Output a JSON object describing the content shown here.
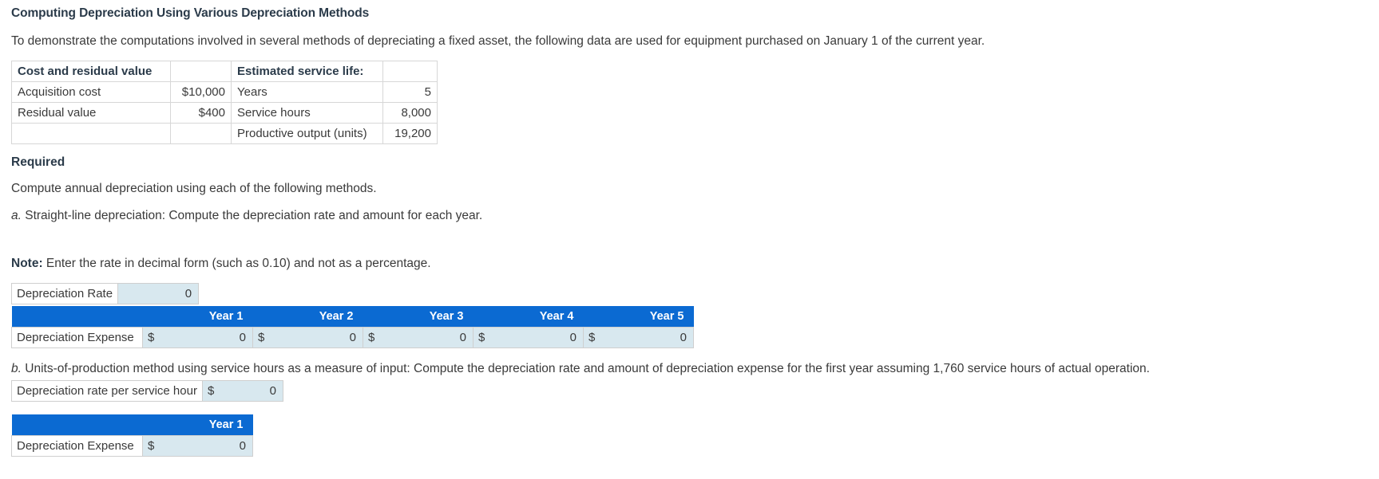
{
  "page": {
    "title": "Computing Depreciation Using Various Depreciation Methods",
    "intro": "To demonstrate the computations involved in several methods of depreciating a fixed asset, the following data are used for equipment purchased on January 1 of the current year.",
    "required_heading": "Required",
    "required_text": "Compute annual depreciation using each of the following methods.",
    "part_a_letter": "a.",
    "part_a_text": "Straight-line depreciation: Compute the depreciation rate and amount for each year.",
    "note_label": "Note:",
    "note_text": "Enter the rate in decimal form (such as 0.10) and not as a percentage.",
    "part_b_letter": "b.",
    "part_b_text": "Units-of-production method using service hours as a measure of input: Compute the depreciation rate and amount of depreciation expense for the first year assuming 1,760 service hours of actual operation."
  },
  "fact_table": {
    "header_left": "Cost and residual value",
    "header_right": "Estimated service life:",
    "rows": [
      {
        "left_label": "Acquisition cost",
        "left_value": "$10,000",
        "right_label": "Years",
        "right_value": "5"
      },
      {
        "left_label": "Residual value",
        "left_value": "$400",
        "right_label": "Service hours",
        "right_value": "8,000"
      },
      {
        "left_label": "",
        "left_value": "",
        "right_label": "Productive output (units)",
        "right_value": "19,200"
      }
    ]
  },
  "part_a": {
    "rate_label": "Depreciation Rate",
    "rate_value": "0",
    "year_headers": [
      "Year 1",
      "Year 2",
      "Year 3",
      "Year 4",
      "Year 5"
    ],
    "expense_label": "Depreciation Expense",
    "currency_symbol": "$",
    "expense_values": [
      "0",
      "0",
      "0",
      "0",
      "0"
    ]
  },
  "part_b": {
    "rate_label": "Depreciation rate per service hour",
    "rate_currency": "$",
    "rate_value": "0",
    "year_headers": [
      "Year 1"
    ],
    "expense_label": "Depreciation Expense",
    "currency_symbol": "$",
    "expense_values": [
      "0"
    ]
  },
  "colors": {
    "header_blue": "#0b6ad2",
    "input_fill": "#d8e8ef",
    "text": "#3a3a3a",
    "heading": "#2b3b4a"
  }
}
